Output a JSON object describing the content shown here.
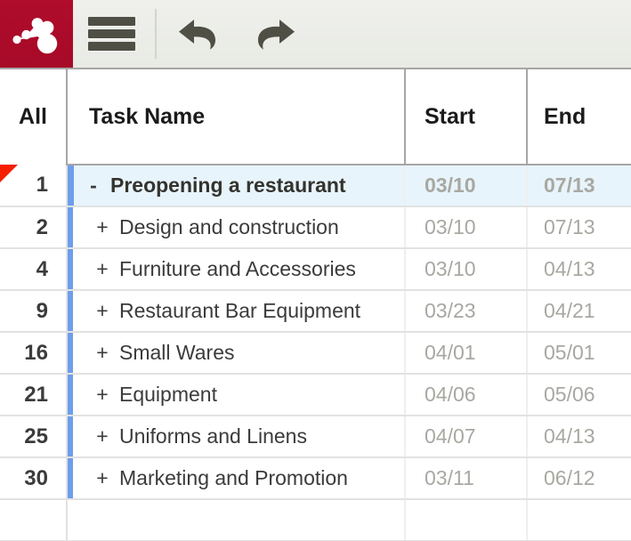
{
  "toolbar": {
    "logo_icon": "app-logo-icon",
    "menu_label": "menu-icon",
    "undo_label": "undo-icon",
    "redo_label": "redo-icon",
    "brand_color": "#ad0b2a",
    "background_color": "#eceee9",
    "icon_color": "#4f4f45"
  },
  "grid": {
    "columns": [
      {
        "key": "num",
        "label": "All"
      },
      {
        "key": "name",
        "label": "Task Name"
      },
      {
        "key": "start",
        "label": "Start"
      },
      {
        "key": "end",
        "label": "End"
      }
    ],
    "selected_row_background": "#e8f4fb",
    "indicator_color": "#6d9eeb",
    "marker_color": "#f51f00",
    "date_color": "#a8a8a2",
    "rows": [
      {
        "num": "1",
        "toggle": "-",
        "name": "Preopening a restaurant",
        "start": "03/10",
        "end": "07/13",
        "selected": true,
        "marker": true,
        "indicator": true
      },
      {
        "num": "2",
        "toggle": "+",
        "name": "Design and construction",
        "start": "03/10",
        "end": "07/13",
        "selected": false,
        "marker": false,
        "indicator": true
      },
      {
        "num": "4",
        "toggle": "+",
        "name": "Furniture and Accessories",
        "start": "03/10",
        "end": "04/13",
        "selected": false,
        "marker": false,
        "indicator": true
      },
      {
        "num": "9",
        "toggle": "+",
        "name": "Restaurant Bar Equipment",
        "start": "03/23",
        "end": "04/21",
        "selected": false,
        "marker": false,
        "indicator": true
      },
      {
        "num": "16",
        "toggle": "+",
        "name": "Small Wares",
        "start": "04/01",
        "end": "05/01",
        "selected": false,
        "marker": false,
        "indicator": true
      },
      {
        "num": "21",
        "toggle": "+",
        "name": "Equipment",
        "start": "04/06",
        "end": "05/06",
        "selected": false,
        "marker": false,
        "indicator": true
      },
      {
        "num": "25",
        "toggle": "+",
        "name": "Uniforms and Linens",
        "start": "04/07",
        "end": "04/13",
        "selected": false,
        "marker": false,
        "indicator": true
      },
      {
        "num": "30",
        "toggle": "+",
        "name": "Marketing and Promotion",
        "start": "03/11",
        "end": "06/12",
        "selected": false,
        "marker": false,
        "indicator": true
      },
      {
        "num": "",
        "toggle": "",
        "name": "",
        "start": "",
        "end": "",
        "selected": false,
        "marker": false,
        "indicator": false
      }
    ]
  }
}
